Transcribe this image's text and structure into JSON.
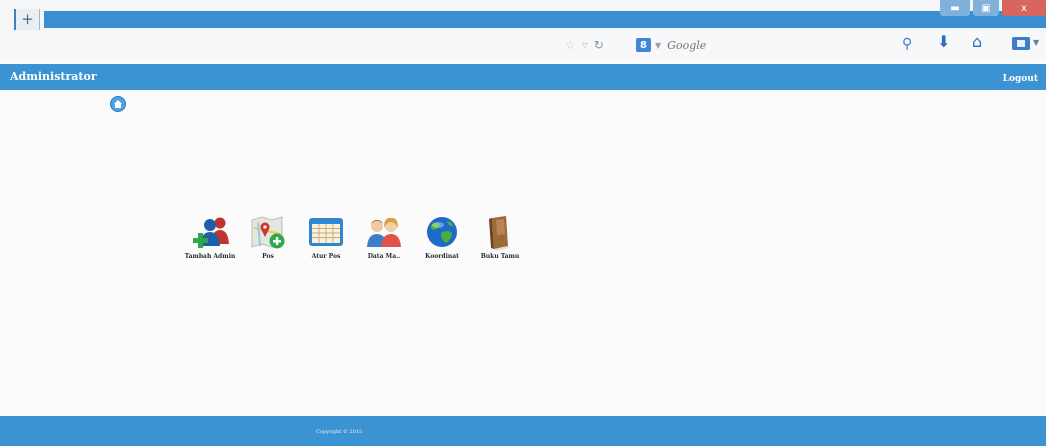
{
  "browser": {
    "new_tab_glyph": "+",
    "window_controls": {
      "minimize": "▬",
      "maximize": "▣",
      "close": "x"
    },
    "search": {
      "engine_badge": "8",
      "placeholder": "Google"
    },
    "icons": [
      "star-icon",
      "reader-icon",
      "reload-icon",
      "search-magnifier-icon",
      "download-icon",
      "home-icon",
      "bookmarks-icon"
    ]
  },
  "header": {
    "title": "Administrator",
    "logout": "Logout",
    "color": "#3c93d4"
  },
  "menu": {
    "items": [
      {
        "label": "Tambah Admin",
        "icon": "add-admin-icon"
      },
      {
        "label": "Pos",
        "icon": "map-add-icon"
      },
      {
        "label": "Atur Pos",
        "icon": "table-icon"
      },
      {
        "label": "Data Ma..",
        "icon": "users-icon"
      },
      {
        "label": "Koordinat",
        "icon": "globe-icon"
      },
      {
        "label": "Buku Tamu",
        "icon": "guestbook-icon"
      }
    ]
  },
  "footer": {
    "copyright": "Copyright © 2015"
  }
}
